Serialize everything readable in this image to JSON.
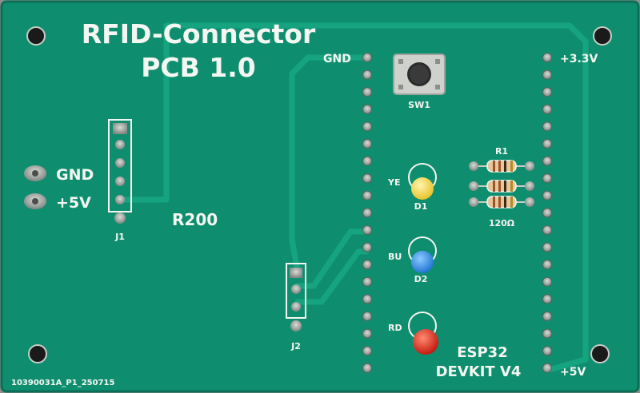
{
  "board": {
    "title_line1": "RFID-Connector",
    "title_line2": "PCB 1.0",
    "r200": "R200",
    "gnd_left": "GND",
    "v5_left": "+5V",
    "j1": "J1",
    "j2": "J2",
    "gnd_header": "GND",
    "v33": "+3.3V",
    "v5_header": "+5V",
    "sw1": "SW1",
    "ye": "YE",
    "d1": "D1",
    "bu": "BU",
    "d2": "D2",
    "rd": "RD",
    "r1": "R1",
    "r_value": "120Ω",
    "esp32_line1": "ESP32",
    "esp32_line2": "DEVKIT V4",
    "part_number": "10390031A_P1_250715"
  },
  "colors": {
    "pcb": "#0f8e6f",
    "trace": "#12a07d",
    "silk": "#f4f6f2",
    "led_yellow": "#f0d238",
    "led_blue": "#2b8fe0",
    "led_red": "#e32418"
  }
}
